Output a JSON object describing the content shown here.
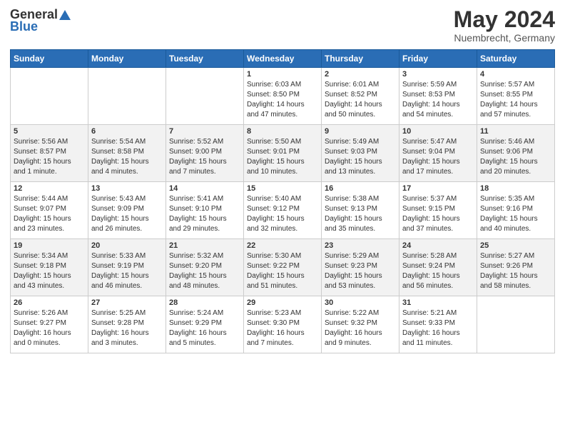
{
  "header": {
    "logo_general": "General",
    "logo_blue": "Blue",
    "title": "May 2024",
    "subtitle": "Nuembrecht, Germany"
  },
  "days": [
    "Sunday",
    "Monday",
    "Tuesday",
    "Wednesday",
    "Thursday",
    "Friday",
    "Saturday"
  ],
  "weeks": [
    [
      {
        "date": "",
        "info": ""
      },
      {
        "date": "",
        "info": ""
      },
      {
        "date": "",
        "info": ""
      },
      {
        "date": "1",
        "info": "Sunrise: 6:03 AM\nSunset: 8:50 PM\nDaylight: 14 hours\nand 47 minutes."
      },
      {
        "date": "2",
        "info": "Sunrise: 6:01 AM\nSunset: 8:52 PM\nDaylight: 14 hours\nand 50 minutes."
      },
      {
        "date": "3",
        "info": "Sunrise: 5:59 AM\nSunset: 8:53 PM\nDaylight: 14 hours\nand 54 minutes."
      },
      {
        "date": "4",
        "info": "Sunrise: 5:57 AM\nSunset: 8:55 PM\nDaylight: 14 hours\nand 57 minutes."
      }
    ],
    [
      {
        "date": "5",
        "info": "Sunrise: 5:56 AM\nSunset: 8:57 PM\nDaylight: 15 hours\nand 1 minute."
      },
      {
        "date": "6",
        "info": "Sunrise: 5:54 AM\nSunset: 8:58 PM\nDaylight: 15 hours\nand 4 minutes."
      },
      {
        "date": "7",
        "info": "Sunrise: 5:52 AM\nSunset: 9:00 PM\nDaylight: 15 hours\nand 7 minutes."
      },
      {
        "date": "8",
        "info": "Sunrise: 5:50 AM\nSunset: 9:01 PM\nDaylight: 15 hours\nand 10 minutes."
      },
      {
        "date": "9",
        "info": "Sunrise: 5:49 AM\nSunset: 9:03 PM\nDaylight: 15 hours\nand 13 minutes."
      },
      {
        "date": "10",
        "info": "Sunrise: 5:47 AM\nSunset: 9:04 PM\nDaylight: 15 hours\nand 17 minutes."
      },
      {
        "date": "11",
        "info": "Sunrise: 5:46 AM\nSunset: 9:06 PM\nDaylight: 15 hours\nand 20 minutes."
      }
    ],
    [
      {
        "date": "12",
        "info": "Sunrise: 5:44 AM\nSunset: 9:07 PM\nDaylight: 15 hours\nand 23 minutes."
      },
      {
        "date": "13",
        "info": "Sunrise: 5:43 AM\nSunset: 9:09 PM\nDaylight: 15 hours\nand 26 minutes."
      },
      {
        "date": "14",
        "info": "Sunrise: 5:41 AM\nSunset: 9:10 PM\nDaylight: 15 hours\nand 29 minutes."
      },
      {
        "date": "15",
        "info": "Sunrise: 5:40 AM\nSunset: 9:12 PM\nDaylight: 15 hours\nand 32 minutes."
      },
      {
        "date": "16",
        "info": "Sunrise: 5:38 AM\nSunset: 9:13 PM\nDaylight: 15 hours\nand 35 minutes."
      },
      {
        "date": "17",
        "info": "Sunrise: 5:37 AM\nSunset: 9:15 PM\nDaylight: 15 hours\nand 37 minutes."
      },
      {
        "date": "18",
        "info": "Sunrise: 5:35 AM\nSunset: 9:16 PM\nDaylight: 15 hours\nand 40 minutes."
      }
    ],
    [
      {
        "date": "19",
        "info": "Sunrise: 5:34 AM\nSunset: 9:18 PM\nDaylight: 15 hours\nand 43 minutes."
      },
      {
        "date": "20",
        "info": "Sunrise: 5:33 AM\nSunset: 9:19 PM\nDaylight: 15 hours\nand 46 minutes."
      },
      {
        "date": "21",
        "info": "Sunrise: 5:32 AM\nSunset: 9:20 PM\nDaylight: 15 hours\nand 48 minutes."
      },
      {
        "date": "22",
        "info": "Sunrise: 5:30 AM\nSunset: 9:22 PM\nDaylight: 15 hours\nand 51 minutes."
      },
      {
        "date": "23",
        "info": "Sunrise: 5:29 AM\nSunset: 9:23 PM\nDaylight: 15 hours\nand 53 minutes."
      },
      {
        "date": "24",
        "info": "Sunrise: 5:28 AM\nSunset: 9:24 PM\nDaylight: 15 hours\nand 56 minutes."
      },
      {
        "date": "25",
        "info": "Sunrise: 5:27 AM\nSunset: 9:26 PM\nDaylight: 15 hours\nand 58 minutes."
      }
    ],
    [
      {
        "date": "26",
        "info": "Sunrise: 5:26 AM\nSunset: 9:27 PM\nDaylight: 16 hours\nand 0 minutes."
      },
      {
        "date": "27",
        "info": "Sunrise: 5:25 AM\nSunset: 9:28 PM\nDaylight: 16 hours\nand 3 minutes."
      },
      {
        "date": "28",
        "info": "Sunrise: 5:24 AM\nSunset: 9:29 PM\nDaylight: 16 hours\nand 5 minutes."
      },
      {
        "date": "29",
        "info": "Sunrise: 5:23 AM\nSunset: 9:30 PM\nDaylight: 16 hours\nand 7 minutes."
      },
      {
        "date": "30",
        "info": "Sunrise: 5:22 AM\nSunset: 9:32 PM\nDaylight: 16 hours\nand 9 minutes."
      },
      {
        "date": "31",
        "info": "Sunrise: 5:21 AM\nSunset: 9:33 PM\nDaylight: 16 hours\nand 11 minutes."
      },
      {
        "date": "",
        "info": ""
      }
    ]
  ]
}
